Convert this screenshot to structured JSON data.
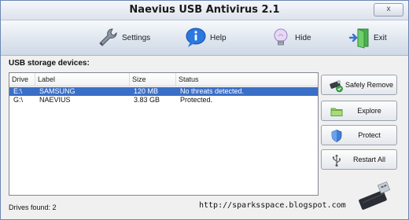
{
  "window": {
    "title": "Naevius USB Antivirus 2.1",
    "close_glyph": "x"
  },
  "toolbar": {
    "items": [
      {
        "label": "Settings",
        "icon": "wrench-icon"
      },
      {
        "label": "Help",
        "icon": "info-bubble-icon"
      },
      {
        "label": "Hide",
        "icon": "lightbulb-icon"
      },
      {
        "label": "Exit",
        "icon": "exit-door-icon"
      }
    ]
  },
  "devices": {
    "section_label": "USB storage devices:",
    "columns": [
      "Drive",
      "Label",
      "Size",
      "Status"
    ],
    "rows": [
      {
        "drive": "E:\\",
        "label": "SAMSUNG",
        "size": "120 MB",
        "status": "No threats detected.",
        "selected": true
      },
      {
        "drive": "G:\\",
        "label": "NAEVIUS",
        "size": "3.83 GB",
        "status": "Protected.",
        "selected": false
      }
    ]
  },
  "actions": {
    "safely_remove": "Safely Remove",
    "explore": "Explore",
    "protect": "Protect",
    "restart_all": "Restart All"
  },
  "footer": {
    "drives_found": "Drives found: 2",
    "url": "http://sparksspace.blogspot.com"
  },
  "colors": {
    "selection": "#3a6fc7",
    "accent": "#2a6fd6"
  }
}
